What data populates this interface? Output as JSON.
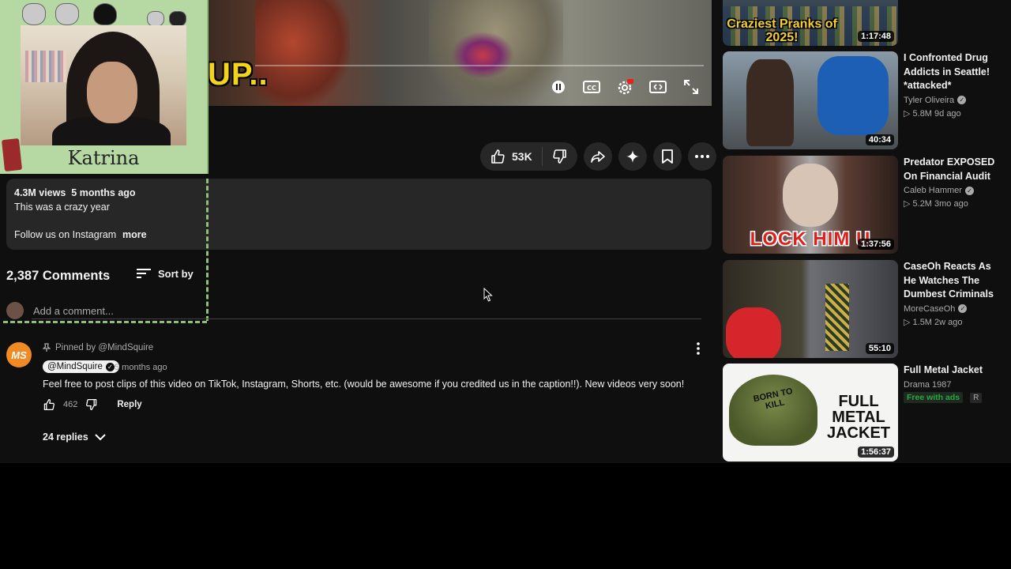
{
  "video": {
    "overlay_text": "UP.."
  },
  "facecam": {
    "name": "Katrina"
  },
  "actions": {
    "like_count": "53K"
  },
  "description": {
    "views": "4.3M views",
    "age": "5 months ago",
    "line1": "This was a crazy year",
    "line2": "Follow us on Instagram",
    "more": "more"
  },
  "comments": {
    "count_label": "2,387 Comments",
    "sort_label": "Sort by",
    "add_placeholder": "Add a comment...",
    "pinned": {
      "pinned_by": "Pinned by @MindSquire",
      "author": "@MindSquire",
      "avatar_text": "MS",
      "time": "5 months ago",
      "text": "Feel free to post clips of this video on TikTok, Instagram, Shorts, etc. (would be awesome if you credited us in the caption!!). New videos very soon!",
      "likes": "462",
      "reply_label": "Reply",
      "replies_label": "24 replies"
    }
  },
  "sidebar": {
    "items": [
      {
        "thumb_text": "Craziest Pranks of 2025!",
        "duration": "1:17:48"
      },
      {
        "title": "I Confronted Drug Addicts in Seattle! *attacked*",
        "channel": "Tyler Oliveira",
        "stats": "▷ 5.8M   9d ago",
        "duration": "40:34"
      },
      {
        "title": "Predator EXPOSED On Financial Audit",
        "channel": "Caleb Hammer",
        "stats": "▷ 5.2M   3mo ago",
        "duration": "1:37:56",
        "thumb_text": "LOCK HIM U"
      },
      {
        "title": "CaseOh Reacts As He Watches The Dumbest Criminals",
        "channel": "MoreCaseOh",
        "stats": "▷ 1.5M   2w ago",
        "duration": "55:10"
      },
      {
        "title": "Full Metal Jacket",
        "channel": "Drama 1987",
        "badge_free": "Free with ads",
        "badge_rating": "R",
        "duration": "1:56:37",
        "thumb_text": "FULL METAL JACKET",
        "helmet_text": "BORN TO KILL"
      }
    ]
  },
  "colors": {
    "background": "#0f0f0f",
    "card": "#272727",
    "accent_green": "#8fbf78",
    "free_green": "#2ba640",
    "avatar_orange": "#f08a24"
  }
}
